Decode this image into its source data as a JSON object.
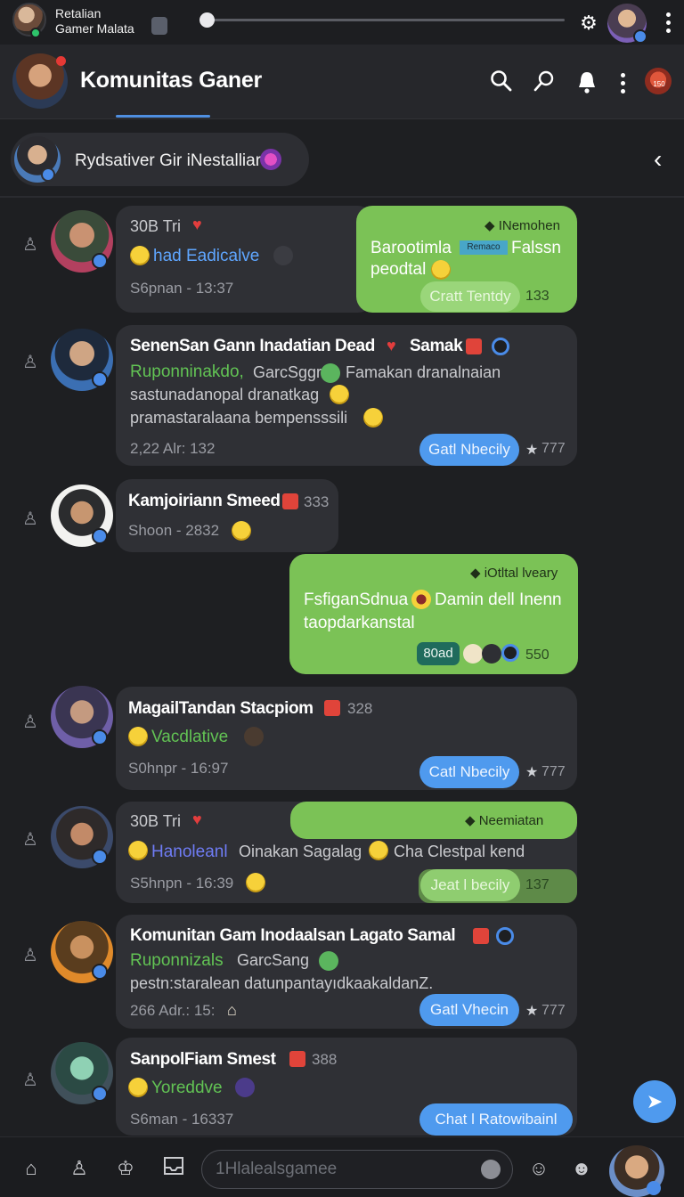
{
  "status_bar": {
    "name_line1": "Retalian",
    "name_line2": "Gamer Malata"
  },
  "header": {
    "title": "Komunitas Ganer",
    "pill_text": "150"
  },
  "channel": {
    "name": "Rydsativer Gir iNestalliar"
  },
  "messages": [
    {
      "line1": "30B Tri",
      "role": "had Eadicalve",
      "meta": "S6pnan - 13:37"
    },
    {
      "name": "SenenSan Gann Inadatian Dead",
      "name_suffix": "Samak",
      "role": "Ruponninakdo,",
      "line1_rest": "GarcSggr",
      "line1_tail": "Famakan dranalnaian",
      "line2": "sastunadanopal dranatkag",
      "line3": "pramastaralaana bempensssili",
      "meta": "2,22 Alr: 132",
      "button": "Gatl Nbecily",
      "stars": "777"
    },
    {
      "name": "Kamjoiriann Smeed",
      "count": "333",
      "meta": "Shoon - 2832"
    },
    {
      "name": "MagailTandan Stacpiom",
      "count": "328",
      "role": "Vacdlative",
      "meta": "S0hnpr - 16:97",
      "button": "Catl Nbecily",
      "stars": "777"
    },
    {
      "line1": "30B Tri",
      "role": "Hanoleanl",
      "rest": "Oinakan Sagalag",
      "tail": "Cha  Clestpal kend",
      "meta": "S5hnpn - 16:39"
    },
    {
      "name": "Komunitan Gam Inodaalsan Lagato Samal",
      "role": "Ruponnizals",
      "role_rest": "GarcSang",
      "line2": "pestn:staralean datunpantayıdkaakaldanZ.",
      "meta": "266 Adr.: 15:",
      "button": "Gatl Vhecin",
      "stars": "777"
    },
    {
      "name": "SanpolFiam Smest",
      "count": "388",
      "role": "Yoreddve",
      "meta": "S6man - 16337",
      "button": "Chat l Ratowibainl"
    }
  ],
  "green_bubbles": [
    {
      "header": "INemohen",
      "text1": "Barootimla",
      "tag": "Remaco",
      "text1_tail": "Falssn",
      "text2": "peodtal",
      "button": "Cratt Tentdy",
      "time": "133"
    },
    {
      "header": "iOtltal lveary",
      "text1": "FsfiganSdnua",
      "text1_tail": "Damin dell Inenn",
      "text2": "taopdarkanstal",
      "chip": "80ad",
      "time": "550"
    },
    {
      "header": "Neemiatan",
      "button": "Jeat l becily",
      "time": "137"
    }
  ],
  "bottom_bar": {
    "input_placeholder": "1Hlalealsgamee"
  },
  "colors": {
    "background": "#1e1f22",
    "bubble_dark": "#2f3035",
    "bubble_green": "#7bc256",
    "accent_blue": "#4f9aee",
    "role_green": "#62c354",
    "role_blue": "#5fa6ff"
  },
  "icons": {
    "settings": "gear-icon",
    "search": "search-icon",
    "pin": "pin-icon",
    "bell": "bell-icon",
    "back": "chevron-left-icon",
    "home": "home-icon",
    "user": "user-icon",
    "crown": "crown-icon",
    "inbox": "inbox-icon",
    "emoji": "smile-icon",
    "sticker": "sticker-icon",
    "compose": "compose-icon"
  }
}
